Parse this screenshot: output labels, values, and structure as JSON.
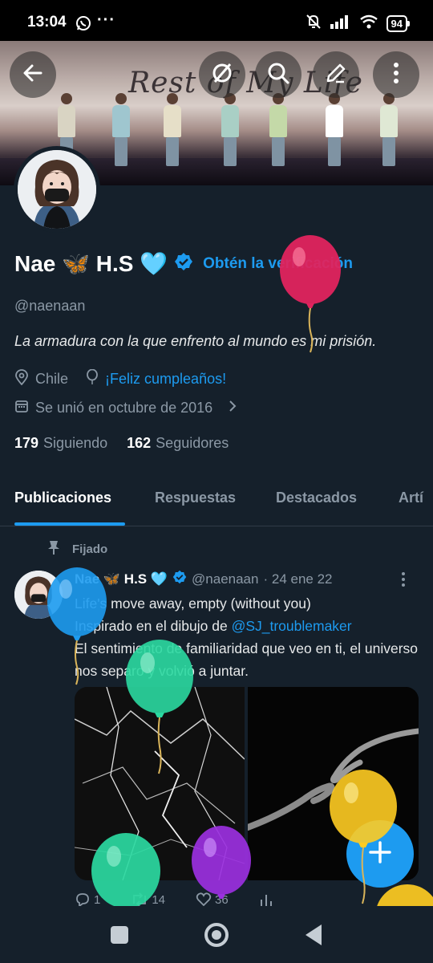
{
  "status_bar": {
    "time": "13:04",
    "more": "···",
    "battery": "94"
  },
  "banner": {
    "text": "Rest of My Life"
  },
  "header_buttons": {
    "back": "arrow-left-icon",
    "grok": "grok-icon",
    "search": "search-icon",
    "edit": "pencil-icon",
    "more": "more-vertical-icon"
  },
  "profile": {
    "name": "Nae 🦋 H.S 🩵",
    "verification_link": "Obtén la verificación",
    "handle": "@naenaan",
    "bio": "La armadura con la que enfrento al mundo es mi prisión.",
    "location": "Chile",
    "birthday": "¡Feliz cumpleaños!",
    "joined": "Se unió en octubre de 2016",
    "following_count": "179",
    "following_label": "Siguiendo",
    "followers_count": "162",
    "followers_label": "Seguidores"
  },
  "tabs": [
    {
      "label": "Publicaciones"
    },
    {
      "label": "Respuestas"
    },
    {
      "label": "Destacados"
    },
    {
      "label": "Artí"
    }
  ],
  "post": {
    "pinned_label": "Fijado",
    "author_name": "Nae 🦋 H.S 🩵",
    "author_handle": "@naenaan",
    "date": "· 24 ene 22",
    "line1": "Life's move away, empty (without you)",
    "line2_prefix": "Inspirado en el dibujo de ",
    "line2_mention": "@SJ_troublemaker",
    "line3": "El sentimiento de familiaridad que veo en ti, el universo nos separo y volvió a juntar.",
    "replies": "1",
    "reposts": "14",
    "likes": "36"
  },
  "colors": {
    "background": "#15202b",
    "accent": "#1d9bf0",
    "muted": "#8b98a5"
  }
}
